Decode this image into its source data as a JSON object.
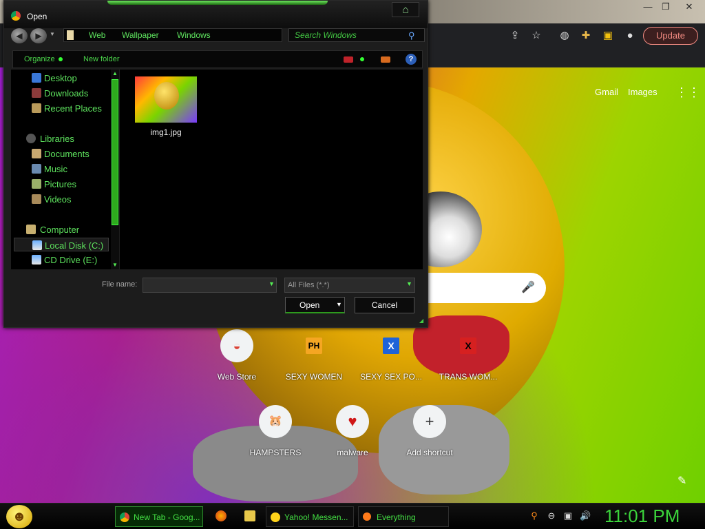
{
  "dialog": {
    "title": "Open",
    "breadcrumbs": [
      "Web",
      "Wallpaper",
      "Windows"
    ],
    "search_placeholder": "Search Windows",
    "toolbar": {
      "organize_label": "Organize",
      "new_folder_label": "New folder"
    },
    "nav_items": [
      {
        "label": "Desktop",
        "icon": "desktop-icon"
      },
      {
        "label": "Downloads",
        "icon": "downloads-icon"
      },
      {
        "label": "Recent Places",
        "icon": "recent-places-icon"
      },
      {
        "label": "Libraries",
        "icon": "libraries-icon"
      },
      {
        "label": "Documents",
        "icon": "documents-icon"
      },
      {
        "label": "Music",
        "icon": "music-icon"
      },
      {
        "label": "Pictures",
        "icon": "pictures-icon"
      },
      {
        "label": "Videos",
        "icon": "videos-icon"
      },
      {
        "label": "Computer",
        "icon": "computer-icon"
      },
      {
        "label": "Local Disk (C:)",
        "icon": "local-disk-icon",
        "selected": true
      },
      {
        "label": "CD Drive (E:)",
        "icon": "cd-drive-icon"
      }
    ],
    "files": [
      {
        "name": "img1.jpg"
      }
    ],
    "filename_label": "File name:",
    "filename_value": "",
    "filetype_value": "All Files (*.*)",
    "open_label": "Open",
    "cancel_label": "Cancel"
  },
  "browser": {
    "update_label": "Update",
    "ntp": {
      "gmail_label": "Gmail",
      "images_label": "Images",
      "shortcuts": [
        {
          "label": "Web Store",
          "glyph": "◒"
        },
        {
          "label": "SEXY WOMEN",
          "glyph": "PH"
        },
        {
          "label": "SEXY SEX PO...",
          "glyph": "X"
        },
        {
          "label": "TRANS WOM...",
          "glyph": "X"
        },
        {
          "label": "HAMPSTERS",
          "glyph": "🐹"
        },
        {
          "label": "malware",
          "glyph": "♥"
        },
        {
          "label": "Add shortcut",
          "glyph": "+"
        }
      ]
    }
  },
  "taskbar": {
    "tasks": [
      {
        "label": "New Tab - Goog...",
        "icon": "chrome-icon"
      },
      {
        "label": "Yahoo! Messen...",
        "icon": "yahoo-messenger-icon"
      },
      {
        "label": "Everything",
        "icon": "everything-search-icon"
      }
    ],
    "clock": "11:01 PM"
  },
  "colors": {
    "accent_green": "#43e043",
    "update_red": "#f28b82"
  }
}
